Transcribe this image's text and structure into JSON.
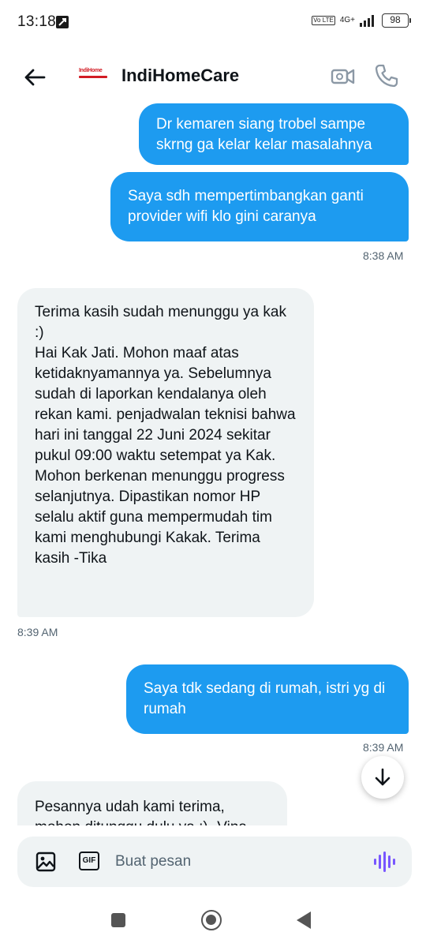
{
  "status_bar": {
    "time": "13:18",
    "network": "4G+",
    "volte": "Vo LTE",
    "battery": "98"
  },
  "header": {
    "contact_name": "IndiHomeCare",
    "logo_text": "IndiHome"
  },
  "messages": [
    {
      "type": "sent",
      "text": "Dr kemaren siang trobel sampe skrng ga kelar kelar masalahnya"
    },
    {
      "type": "sent",
      "text": "Saya sdh mempertimbangkan ganti provider wifi klo gini caranya",
      "time": "8:38 AM"
    },
    {
      "type": "received",
      "text": "Terima kasih sudah menunggu ya kak :)\nHai Kak Jati. Mohon maaf atas ketidaknyamannya ya. Sebelumnya sudah di laporkan kendalanya oleh rekan kami. penjadwalan teknisi bahwa hari ini tanggal 22 Juni 2024 sekitar pukul 09:00 waktu setempat ya Kak. Mohon berkenan menunggu progress selanjutnya. Dipastikan nomor HP selalu aktif guna mempermudah tim kami menghubungi Kakak. Terima kasih -Tika",
      "time": "8:39 AM"
    },
    {
      "type": "sent",
      "text": "Saya tdk sedang di rumah, istri yg di rumah",
      "time": "8:39 AM"
    },
    {
      "type": "received",
      "text": "Pesannya udah kami terima, mohon ditunggu dulu ya :) -Vina"
    }
  ],
  "composer": {
    "placeholder": "Buat pesan",
    "gif_label": "GIF"
  },
  "colors": {
    "sent_bubble": "#1d9bf0",
    "received_bubble": "#eff3f4",
    "voice_accent": "#7856ff"
  },
  "icons": [
    "back-arrow-icon",
    "video-call-icon",
    "phone-icon",
    "image-icon",
    "gif-icon",
    "voice-icon",
    "arrow-down-icon"
  ]
}
